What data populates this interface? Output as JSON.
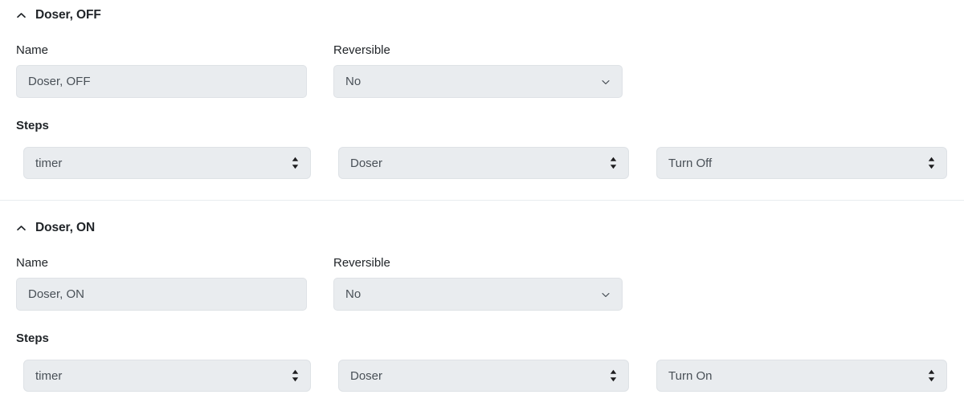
{
  "sections": [
    {
      "id": "doser-off",
      "caret": "chevron-up-icon",
      "title": "Doser, OFF",
      "name_label": "Name",
      "name_value": "Doser, OFF",
      "reversible_label": "Reversible",
      "reversible_value": "No",
      "steps_label": "Steps",
      "steps": [
        {
          "value": "timer",
          "icon": "up-down-arrows-icon"
        },
        {
          "value": "Doser",
          "icon": "up-down-arrows-icon"
        },
        {
          "value": "Turn Off",
          "icon": "up-down-arrows-icon"
        }
      ]
    },
    {
      "id": "doser-on",
      "caret": "chevron-up-icon",
      "title": "Doser, ON",
      "name_label": "Name",
      "name_value": "Doser, ON",
      "reversible_label": "Reversible",
      "reversible_value": "No",
      "steps_label": "Steps",
      "steps": [
        {
          "value": "timer",
          "icon": "up-down-arrows-icon"
        },
        {
          "value": "Doser",
          "icon": "up-down-arrows-icon"
        },
        {
          "value": "Turn On",
          "icon": "up-down-arrows-icon"
        }
      ]
    }
  ],
  "colors": {
    "control_fill": "#e9ecef",
    "control_border": "#dee2e6",
    "text_primary": "#212529",
    "text_control": "#495057",
    "divider": "#e9ecef",
    "page_background": "#ffffff"
  }
}
